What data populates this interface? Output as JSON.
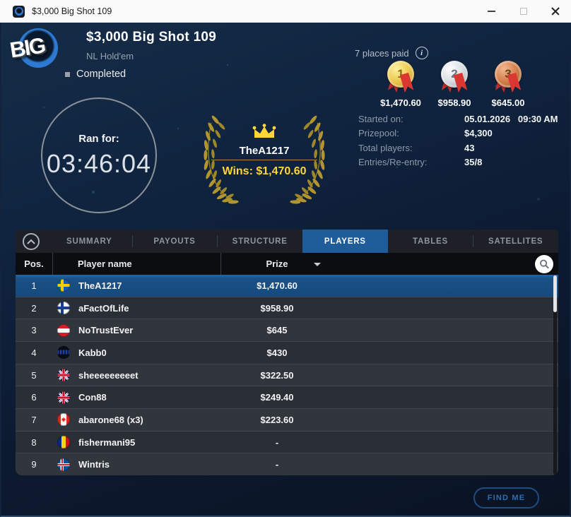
{
  "window": {
    "title": "$3,000 Big Shot 109"
  },
  "header": {
    "logo": "BIG",
    "title": "$3,000 Big Shot 109",
    "game_type": "NL Hold'em",
    "status": "Completed",
    "places_paid": "7 places paid",
    "podium": [
      {
        "rank": "1",
        "prize": "$1,470.60"
      },
      {
        "rank": "2",
        "prize": "$958.90"
      },
      {
        "rank": "3",
        "prize": "$645.00"
      }
    ],
    "ran_for_label": "Ran for:",
    "ran_for_time": "03:46:04",
    "winner": {
      "name": "TheA1217",
      "wins": "Wins: $1,470.60"
    },
    "stats": [
      {
        "label": "Started on:",
        "value": "05.01.2026   09:30 AM"
      },
      {
        "label": "Prizepool:",
        "value": "$4,300"
      },
      {
        "label": "Total players:",
        "value": "43"
      },
      {
        "label": "Entries/Re-entry:",
        "value": "35/8"
      }
    ]
  },
  "tabs": [
    {
      "label": "SUMMARY",
      "active": false
    },
    {
      "label": "PAYOUTS",
      "active": false
    },
    {
      "label": "STRUCTURE",
      "active": false
    },
    {
      "label": "PLAYERS",
      "active": true
    },
    {
      "label": "TABLES",
      "active": false
    },
    {
      "label": "SATELLITES",
      "active": false
    }
  ],
  "table": {
    "columns": {
      "pos": "Pos.",
      "player": "Player name",
      "prize": "Prize"
    },
    "rows": [
      {
        "pos": "1",
        "player": "TheA1217",
        "prize": "$1,470.60",
        "flag": "sweden",
        "selected": true
      },
      {
        "pos": "2",
        "player": "aFactOfLife",
        "prize": "$958.90",
        "flag": "finland",
        "selected": false
      },
      {
        "pos": "3",
        "player": "NoTrustEver",
        "prize": "$645",
        "flag": "austria",
        "selected": false
      },
      {
        "pos": "4",
        "player": "Kabb0",
        "prize": "$430",
        "flag": "dark",
        "selected": false
      },
      {
        "pos": "5",
        "player": "sheeeeeeeeet",
        "prize": "$322.50",
        "flag": "uk",
        "selected": false
      },
      {
        "pos": "6",
        "player": "Con88",
        "prize": "$249.40",
        "flag": "uk",
        "selected": false
      },
      {
        "pos": "7",
        "player": "abarone68 (x3)",
        "prize": "$223.60",
        "flag": "canada",
        "selected": false
      },
      {
        "pos": "8",
        "player": "fishermani95",
        "prize": "-",
        "flag": "romania",
        "selected": false
      },
      {
        "pos": "9",
        "player": "Wintris",
        "prize": "-",
        "flag": "iceland",
        "selected": false
      }
    ]
  },
  "footer": {
    "find_me": "FIND ME"
  },
  "colors": {
    "active_tab": "#1e5c9a",
    "selected_row": "#1a5086",
    "gold_accent": "#ffd636",
    "laurel": "#b2952e",
    "ribbon_red": "#da3732"
  }
}
